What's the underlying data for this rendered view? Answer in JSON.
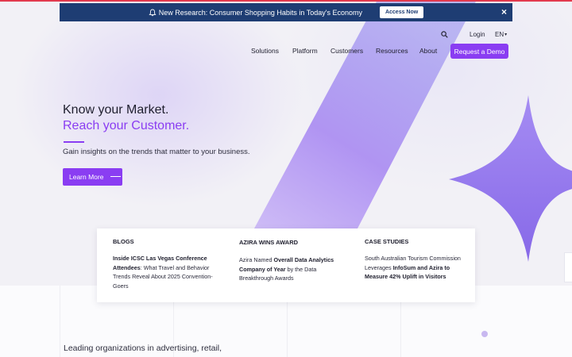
{
  "banner": {
    "text": "New Research: Consumer Shopping Habits in Today's Economy",
    "button": "Access Now",
    "close": "×"
  },
  "utility_nav": {
    "login": "Login",
    "language": "EN"
  },
  "main_nav": {
    "items": [
      "Solutions",
      "Platform",
      "Customers",
      "Resources",
      "About"
    ],
    "cta": "Request a Demo"
  },
  "hero": {
    "line1": "Know your Market.",
    "line2": "Reach your Customer.",
    "subtitle": "Gain insights on the trends that matter to your business.",
    "button": "Learn More"
  },
  "cards": [
    {
      "heading": "BLOGS",
      "bold_part": "Inside ICSC Las Vegas Conference Attendees",
      "rest": ": What Travel and Behavior Trends Reveal About 2025 Convention-Goers"
    },
    {
      "heading": "AZIRA WINS AWARD",
      "pre": "Azira Named ",
      "bold_part": "Overall Data Analytics Company of Year",
      "rest": " by the Data Breakthrough Awards"
    },
    {
      "heading": "CASE STUDIES",
      "pre": "South Australian Tourism Commission Leverages ",
      "bold_part": "InfoSum and Azira to Measure 42% Uplift in Visitors"
    }
  ],
  "lead_text": "Leading organizations in advertising, retail,",
  "colors": {
    "accent": "#8a3df2",
    "banner_bg": "#1e3d73",
    "shape_purple": "#9b7df0"
  }
}
